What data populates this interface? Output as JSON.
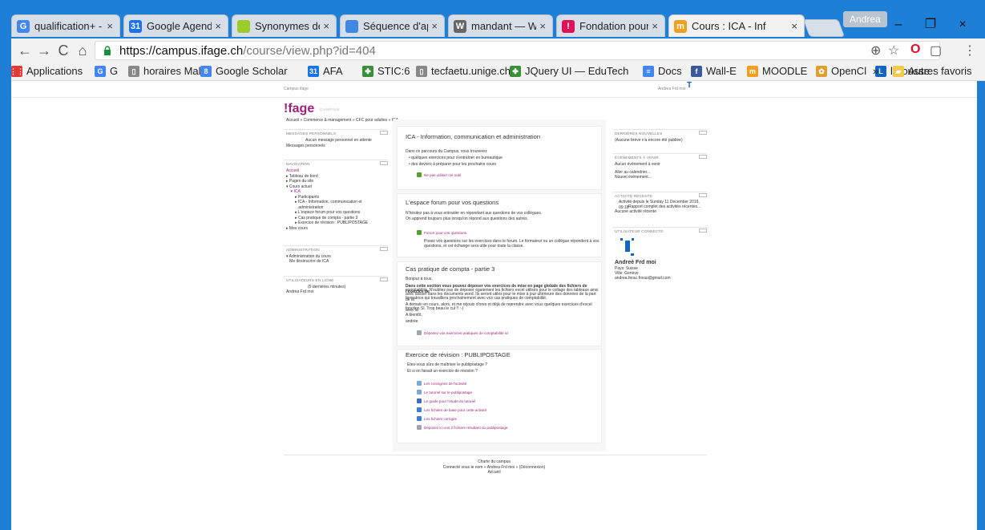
{
  "tabs": [
    {
      "title": "qualification+ -",
      "icon": "G",
      "icon_color": "#4285f4"
    },
    {
      "title": "Google Agenda",
      "icon": "31",
      "icon_color": "#1a73e8"
    },
    {
      "title": "Synonymes de",
      "icon": "",
      "icon_color": "#9ccc2c"
    },
    {
      "title": "Séquence d'app",
      "icon": "",
      "icon_color": "#3f88e6"
    },
    {
      "title": "mandant — Wi",
      "icon": "W",
      "icon_color": "#666666"
    },
    {
      "title": "Fondation pour",
      "icon": "!",
      "icon_color": "#e0105a"
    },
    {
      "title": "Cours : ICA - Inf",
      "icon": "m",
      "icon_color": "#f0a020"
    }
  ],
  "tab_close": "×",
  "profile": "Andrea",
  "window_controls": {
    "minimize": "–",
    "restore": "❐",
    "close": "×"
  },
  "toolbar": {
    "back": "←",
    "forward": "→",
    "reload": "C",
    "home": "⌂",
    "url_scheme_host": "https://campus.ifage.ch",
    "url_path": "/course/view.php?id=404",
    "zoom": "⊕",
    "star": "☆",
    "opera": "O",
    "menu": "⋮"
  },
  "bookmarks": [
    {
      "label": "Applications",
      "icon": "⋮⋮",
      "color": "#e53935"
    },
    {
      "label": "G",
      "icon": "G",
      "color": "#4285f4"
    },
    {
      "label": "horaires Maltt",
      "icon": "▯",
      "color": "#888888"
    },
    {
      "label": "Google Scholar",
      "icon": "8",
      "color": "#4285f4"
    },
    {
      "label": "AFA",
      "icon": "31",
      "color": "#1a73e8"
    },
    {
      "label": "STIC:6",
      "icon": "✤",
      "color": "#3b8f3b"
    },
    {
      "label": "tecfaetu.unige.ch",
      "icon": "▯",
      "color": "#888888"
    },
    {
      "label": "JQuery UI — EduTech",
      "icon": "✤",
      "color": "#3b8f3b"
    },
    {
      "label": "Docs",
      "icon": "≡",
      "color": "#4285f4"
    },
    {
      "label": "Wall-E",
      "icon": "f",
      "color": "#3b5998"
    },
    {
      "label": "MOODLE",
      "icon": "m",
      "color": "#f0a020"
    },
    {
      "label": "OpenCl",
      "icon": "✿",
      "color": "#e0a030"
    },
    {
      "label": "larousse",
      "icon": "L",
      "color": "#1565c0"
    },
    {
      "label": "»",
      "icon": "",
      "color": ""
    },
    {
      "label": "Autres favoris",
      "icon": "▰",
      "color": "#f2c94c"
    }
  ],
  "page": {
    "site_name": "Campus ifage",
    "user_menu": "Andrea Frd moi",
    "logo": "!fage",
    "logo_sub": "CAMPUS",
    "breadcrumb": "Accueil  »  Commerce & management  »  CFC pour adultes  »  ICA",
    "left": {
      "messages_h": "MESSAGES PERSONNELS",
      "messages_empty": "Aucun message personnel en attente",
      "messages_link": "Messages personnels",
      "nav_h": "NAVIGATION",
      "nav_items": [
        "Accueil",
        "▸ Tableau de bord",
        "▸ Pages du site",
        "▾ Cours actuel",
        "    ▾ ICA",
        "        ▸ Participants",
        "        ▸ ICA - Information, communication et",
        "           administration",
        "        ▸ L'espace forum pour vos questions",
        "        ▸ Cas pratique de compta - partie 3",
        "        ▸ Exercice de révision : PUBLIPOSTAGE",
        "▸ Mes cours"
      ],
      "admin_h": "ADMINISTRATION",
      "admin_items": [
        "▾ Administration du cours",
        "   Me désinscrire de ICA"
      ],
      "online_h": "UTILISATEURS EN LIGNE",
      "online_note": "(5 dernières minutes)",
      "online_user": "Andrea Frd moi"
    },
    "center": {
      "s1_title": "ICA - Information, communication et administration",
      "s1_intro": "Dans ce parcours du Campus, vous trouverez",
      "s1_bullets": [
        "quelques exercices pour s'entraîner en bureautique",
        "des devoirs à préparer pour les prochains cours"
      ],
      "s1_activity": "Ne pas utiliser cet outil",
      "s2_title": "L'espace forum pour vos questions",
      "s2_p1": "N'hésitez pas à vous entraider en répondant aux questions de vos collègues.",
      "s2_p2": "On apprend toujours plus lorsqu'on répond aux questions des autres.",
      "s2_activity": "Forum pour vos questions",
      "s2_desc1": "Posez vos questions sur les exercices dans le forum. Le formateur ou un collègue répondent à vos",
      "s2_desc2": "questions, et cet échange sera utile pour toute la classe.",
      "s3_title": "Cas pratique de compta - partie 3",
      "s3_hello": "Bonjour à tous,",
      "s3_p1": "Dans cette section vous pouvez déposer vos exercices de mise en page globale des fichiers de l'exercice de",
      "s3_p2": "comptabilité. N'oubliez pas de déposer également les fichiers excel utilisés pour le collage des tableaux ainsi",
      "s3_p3": "avec laisser dans les documents word. Ils seront utiles pour le mise à jour ultérieure des données de la part de la",
      "s3_p4": "formatrice qui travaillera prochainement avec vos cas pratiques de comptabilité.",
      "s3_p5": "A demain en cours, alors, et me réjouis d'ores et déjà de reprendre avec vous quelques exercices d'excel avec la",
      "s3_p6": "fonction SI. Trop beau le cul !! :-)",
      "s3_bye": "A bientôt,",
      "s3_sign": "andrée",
      "s3_activity": "Déposez vos exercices pratiques de comptabilité ici",
      "s4_title": "Exercice de révision : PUBLIPOSTAGE",
      "s4_q1": "Etes-vous sûrs de maîtriser le publipostage ?",
      "s4_q2": "Et si on faisait un exercice de révision ?",
      "s4_items": [
        "Les consignes de l'activité",
        "Le tutoriel sur le publipostage",
        "Le guide pour l'étude du tutoriel",
        "Les fichiers de base pour cette activité",
        "Les fichiers corrigés",
        "Déposez ici vos 2 fichiers résultant du publipostage"
      ]
    },
    "right": {
      "news_h": "DERNIÈRES NOUVELLES",
      "news_empty": "(Aucune brève n'a encore été publiée)",
      "events_h": "ÉVÉNEMENTS À VENIR",
      "events_empty": "Aucun événement à venir",
      "events_link1": "Aller au calendrier...",
      "events_link2": "Nouvel événement...",
      "activity_h": "ACTIVITÉ RÉCENTE",
      "activity_since": "Activité depuis le Sunday 11 December 2016, 09:18",
      "activity_link": "Rapport complet des activités récentes...",
      "activity_none": "Aucune activité récente",
      "user_h": "UTILISATEUR CONNECTÉ",
      "user_name": "Andreè Frd moi",
      "user_country": "Pays: Suisse",
      "user_city": "Ville: Genève",
      "user_email": "andrea.ferac.frosai@gmail.com"
    },
    "footer": {
      "line1": "Charte du campus",
      "line2": "Connecté sous le nom « Andrea Frd moi » (Déconnexion)",
      "line3": "Accueil"
    }
  }
}
